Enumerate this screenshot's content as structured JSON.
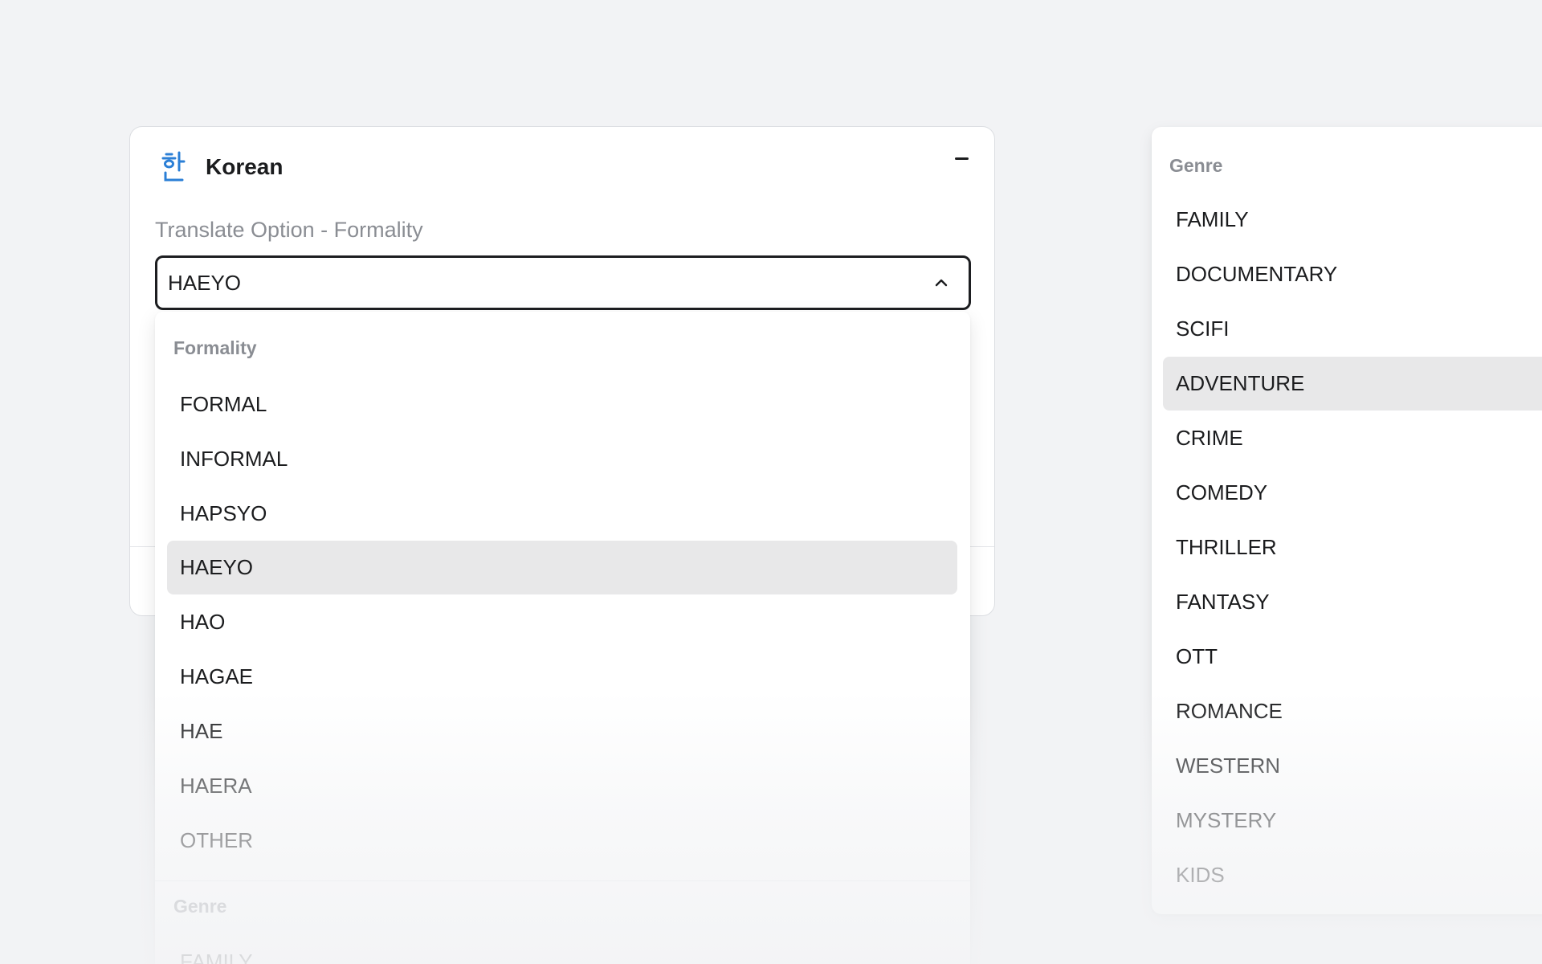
{
  "card": {
    "title": "Korean",
    "field_label": "Translate Option - Formality",
    "selected_value": "HAEYO"
  },
  "menu": {
    "group_label": "Formality",
    "options": [
      "FORMAL",
      "INFORMAL",
      "HAPSYO",
      "HAEYO",
      "HAO",
      "HAGAE",
      "HAE",
      "HAERA",
      "OTHER"
    ],
    "selected": "HAEYO",
    "next_group_label": "Genre",
    "next_group_first_option": "FAMILY"
  },
  "genre_panel": {
    "group_label": "Genre",
    "options": [
      "FAMILY",
      "DOCUMENTARY",
      "SCIFI",
      "ADVENTURE",
      "CRIME",
      "COMEDY",
      "THRILLER",
      "FANTASY",
      "OTT",
      "ROMANCE",
      "WESTERN",
      "MYSTERY",
      "KIDS"
    ],
    "highlighted": "ADVENTURE"
  },
  "icons": {
    "language": "korean-han-icon",
    "collapse": "minus-icon",
    "dropdown": "chevron-up-icon"
  },
  "colors": {
    "accent_blue": "#2b7fd6",
    "selected_bg": "#e8e8e9",
    "muted_text": "#8a8d93"
  }
}
